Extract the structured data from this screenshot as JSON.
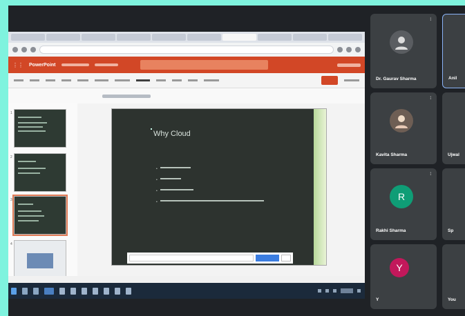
{
  "presentation": {
    "app_name": "PowerPoint",
    "search_placeholder": "",
    "slide_title": "Why Cloud",
    "bullets": [
      "",
      "",
      "",
      ""
    ],
    "bar_placeholder": ""
  },
  "participants": [
    {
      "name": "Dr. Gaurav Sharma",
      "avatar": "user-photo"
    },
    {
      "name": "Anil",
      "avatar": ""
    },
    {
      "name": "Kavita Sharma",
      "avatar": "user-photo"
    },
    {
      "name": "Ujwal",
      "avatar": ""
    },
    {
      "name": "Rakhi Sharma",
      "avatar": "R"
    },
    {
      "name": "Sp",
      "avatar": ""
    },
    {
      "name": "Y",
      "avatar": "Y"
    },
    {
      "name": "You",
      "avatar": ""
    }
  ],
  "colors": {
    "meet_bg": "#1f2226",
    "tile_bg": "#3c4043",
    "ppt_accent": "#d24726",
    "page_border": "#7ff3de"
  }
}
